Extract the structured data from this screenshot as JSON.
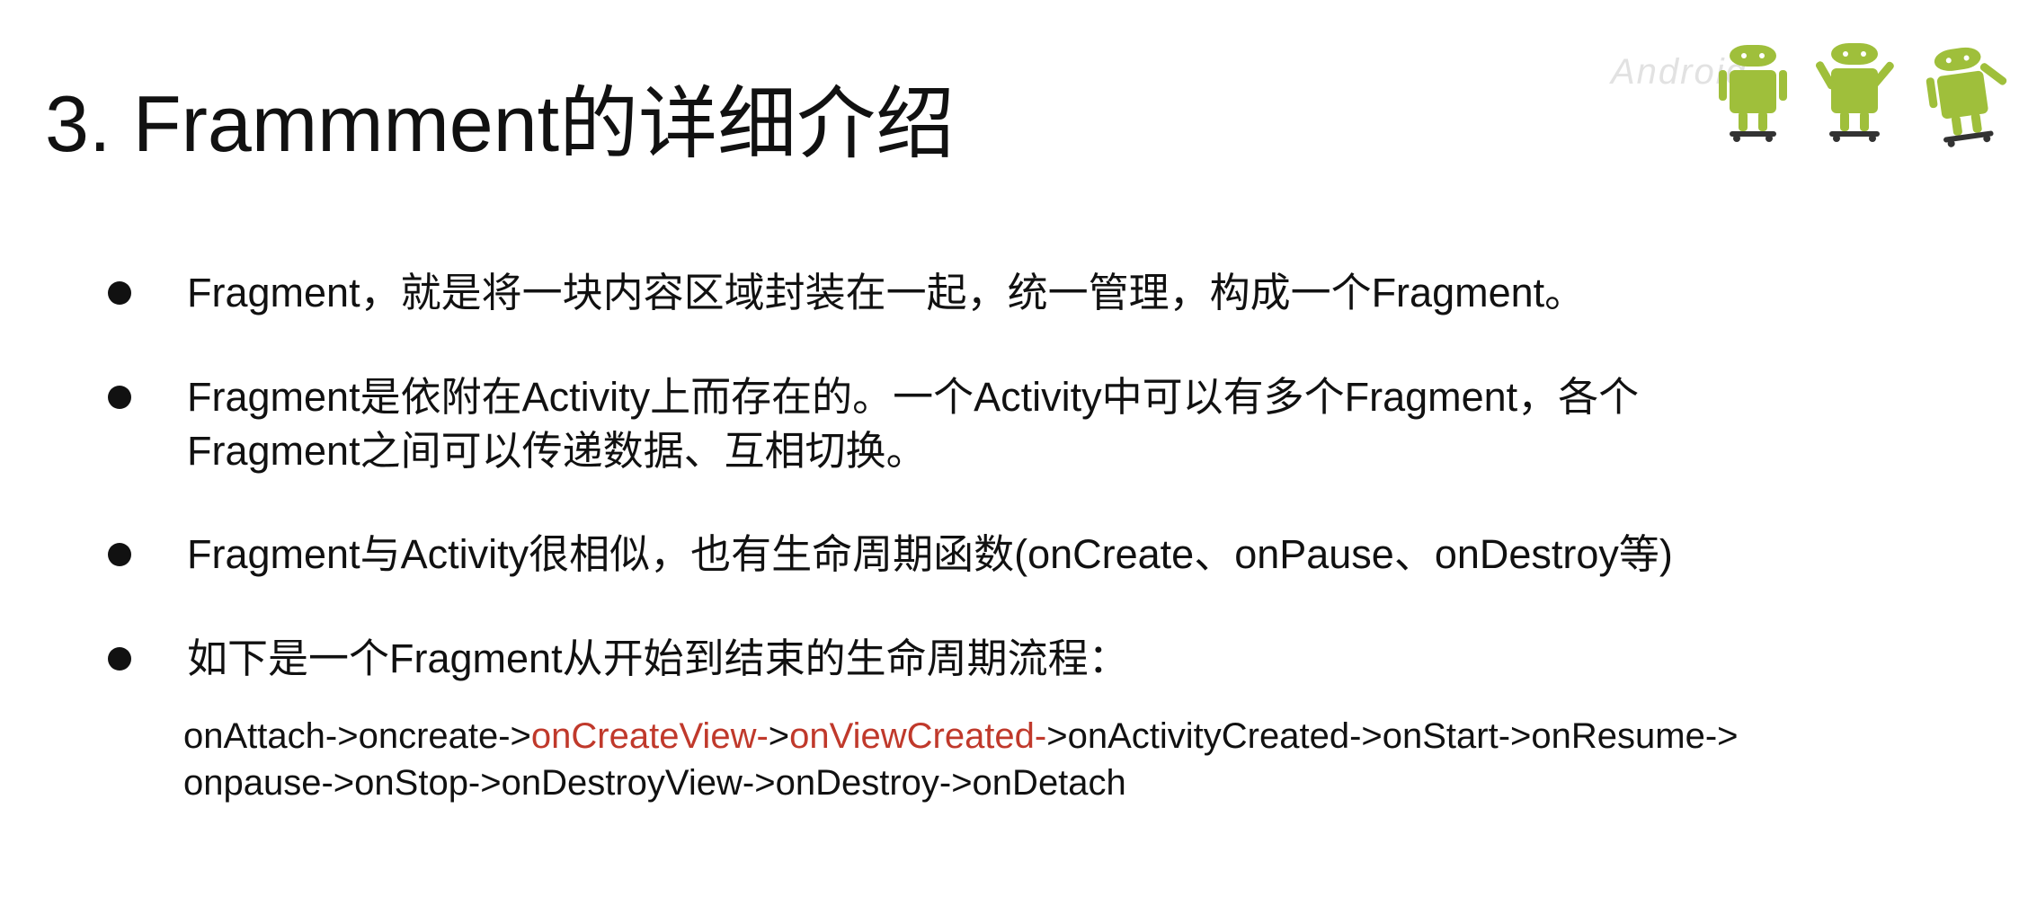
{
  "title": "3. Frammment的详细介绍",
  "bullets": [
    {
      "lines": [
        "Fragment，就是将一块内容区域封装在一起，统一管理，构成一个Fragment。"
      ]
    },
    {
      "lines": [
        "Fragment是依附在Activity上而存在的。一个Activity中可以有多个Fragment，各个",
        "Fragment之间可以传递数据、互相切换。"
      ]
    },
    {
      "lines": [
        "Fragment与Activity很相似，也有生命周期函数(onCreate、onPause、onDestroy等)"
      ]
    },
    {
      "lines": [
        "如下是一个Fragment从开始到结束的生命周期流程："
      ]
    }
  ],
  "lifecycle": {
    "line1": [
      {
        "text": "onAttach->oncreate->",
        "highlight": false
      },
      {
        "text": "onCreateView-",
        "highlight": true
      },
      {
        "text": ">",
        "highlight": false
      },
      {
        "text": "onViewCreated-",
        "highlight": true
      },
      {
        "text": ">onActivityCreated->onStart->onResume->",
        "highlight": false
      }
    ],
    "line2": "onpause->onStop->onDestroyView->onDestroy->onDetach",
    "highlight_color": "#c0392b"
  },
  "logo": {
    "icon": "android-robots-icon",
    "text": "Android",
    "color": "#9fbf3b"
  }
}
